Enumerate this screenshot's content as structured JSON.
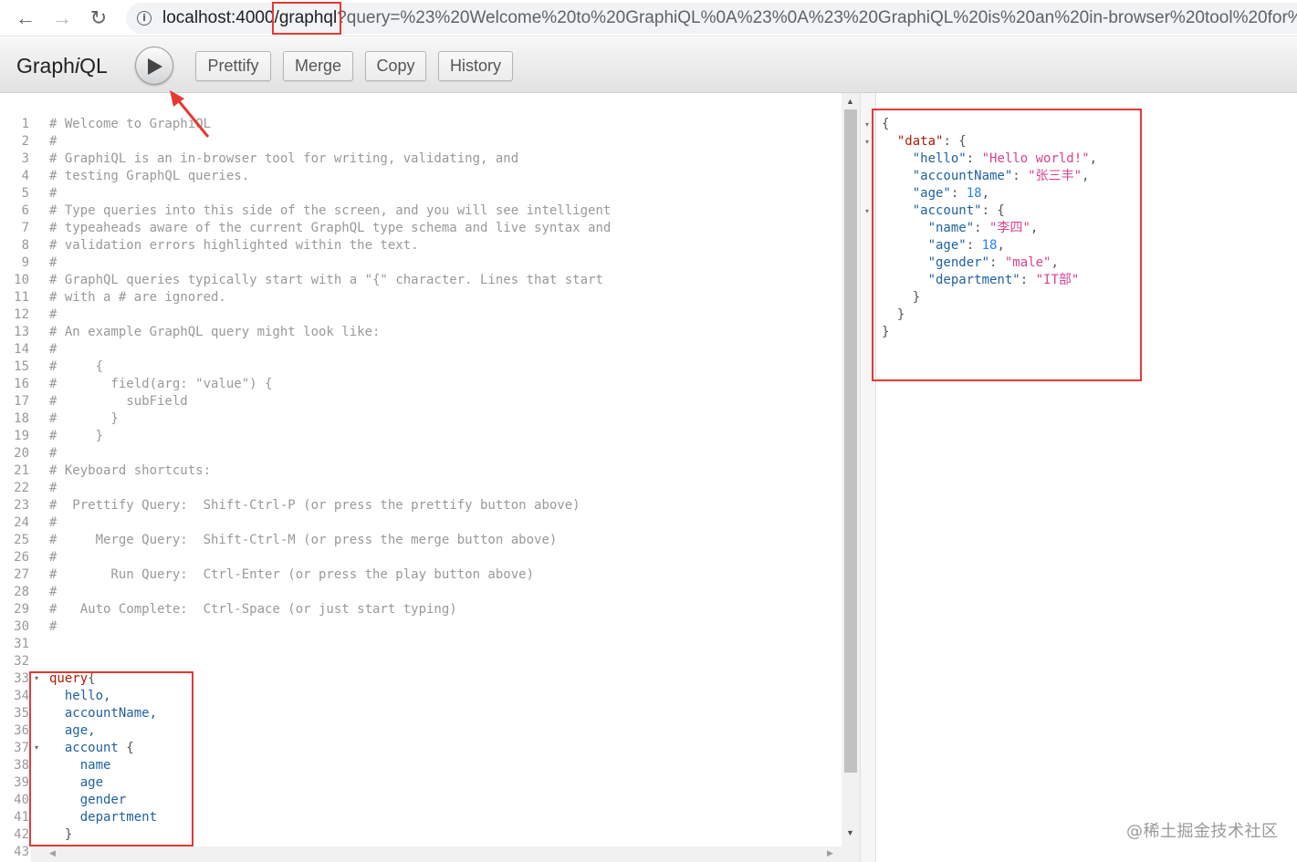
{
  "browser": {
    "url_host": "localhost:4000",
    "url_path": "/graphql",
    "url_query": "?query=%23%20Welcome%20to%20GraphiQL%0A%23%0A%23%20GraphiQL%20is%20an%20in-browser%20tool%20for%20"
  },
  "toolbar": {
    "logo_prefix": "Graph",
    "logo_i": "i",
    "logo_suffix": "QL",
    "prettify_label": "Prettify",
    "merge_label": "Merge",
    "copy_label": "Copy",
    "history_label": "History"
  },
  "editor": {
    "line_numbers": [
      "1",
      "2",
      "3",
      "4",
      "5",
      "6",
      "7",
      "8",
      "9",
      "10",
      "11",
      "12",
      "13",
      "14",
      "15",
      "16",
      "17",
      "18",
      "19",
      "20",
      "21",
      "22",
      "23",
      "24",
      "25",
      "26",
      "27",
      "28",
      "29",
      "30",
      "31",
      "32",
      "33",
      "34",
      "35",
      "36",
      "37",
      "38",
      "39",
      "40",
      "41",
      "42",
      "43"
    ],
    "comment_lines": [
      "# Welcome to GraphiQL",
      "#",
      "# GraphiQL is an in-browser tool for writing, validating, and",
      "# testing GraphQL queries.",
      "#",
      "# Type queries into this side of the screen, and you will see intelligent",
      "# typeaheads aware of the current GraphQL type schema and live syntax and",
      "# validation errors highlighted within the text.",
      "#",
      "# GraphQL queries typically start with a \"{\" character. Lines that start",
      "# with a # are ignored.",
      "#",
      "# An example GraphQL query might look like:",
      "#",
      "#     {",
      "#       field(arg: \"value\") {",
      "#         subField",
      "#       }",
      "#     }",
      "#",
      "# Keyboard shortcuts:",
      "#",
      "#  Prettify Query:  Shift-Ctrl-P (or press the prettify button above)",
      "#",
      "#     Merge Query:  Shift-Ctrl-M (or press the merge button above)",
      "#",
      "#       Run Query:  Ctrl-Enter (or press the play button above)",
      "#",
      "#   Auto Complete:  Ctrl-Space (or just start typing)",
      "#",
      "",
      ""
    ],
    "query_keyword": "query",
    "query_open": "{",
    "query_fields": [
      "hello,",
      "accountName,",
      "age,"
    ],
    "account_field": "account",
    "account_open": " {",
    "account_subfields": [
      "name",
      "age",
      "gender",
      "department"
    ],
    "close_brace": "}"
  },
  "result": {
    "open": "{",
    "data_key": "\"data\"",
    "hello_key": "\"hello\"",
    "hello_val": "\"Hello world!\"",
    "accountName_key": "\"accountName\"",
    "accountName_val": "\"张三丰\"",
    "age_key": "\"age\"",
    "age_val": "18",
    "account_key": "\"account\"",
    "name_key": "\"name\"",
    "name_val": "\"李四\"",
    "acc_age_key": "\"age\"",
    "acc_age_val": "18",
    "gender_key": "\"gender\"",
    "gender_val": "\"male\"",
    "department_key": "\"department\"",
    "department_val": "\"IT部\"",
    "close": "}"
  },
  "watermark": "@稀土掘金技术社区"
}
